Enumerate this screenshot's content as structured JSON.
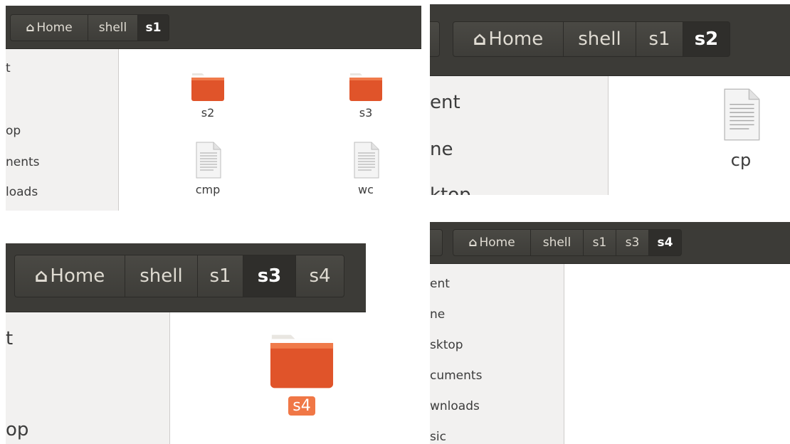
{
  "windows": [
    {
      "crumbs": [
        {
          "label": "Home",
          "home": true
        },
        {
          "label": "shell"
        },
        {
          "label": "s1",
          "active": true
        }
      ],
      "sidebar": [
        "t",
        "op",
        "nents",
        "loads"
      ],
      "files": [
        {
          "name": "s2",
          "type": "folder"
        },
        {
          "name": "s3",
          "type": "folder"
        },
        {
          "name": "cmp",
          "type": "document"
        },
        {
          "name": "wc",
          "type": "document"
        }
      ]
    },
    {
      "crumbs": [
        {
          "label": "Home",
          "home": true
        },
        {
          "label": "shell"
        },
        {
          "label": "s1"
        },
        {
          "label": "s2",
          "active": true
        }
      ],
      "sidebar": [
        "ent",
        "ne",
        "ktop"
      ],
      "files": [
        {
          "name": "cp",
          "type": "document"
        }
      ]
    },
    {
      "crumbs": [
        {
          "label": "Home",
          "home": true
        },
        {
          "label": "shell"
        },
        {
          "label": "s1"
        },
        {
          "label": "s3",
          "active": true
        },
        {
          "label": "s4"
        }
      ],
      "sidebar": [
        "t",
        "op"
      ],
      "files": [
        {
          "name": "s4",
          "type": "folder",
          "selected": true
        }
      ]
    },
    {
      "crumbs": [
        {
          "label": "Home",
          "home": true
        },
        {
          "label": "shell"
        },
        {
          "label": "s1"
        },
        {
          "label": "s3"
        },
        {
          "label": "s4",
          "active": true
        }
      ],
      "sidebar": [
        "ent",
        "ne",
        "sktop",
        "cuments",
        "wnloads",
        "sic"
      ],
      "files": []
    }
  ],
  "icons": {
    "home": "⌂"
  },
  "colors": {
    "toolbar": "#3c3b37",
    "folder": "#e0542a",
    "selection": "#f07746",
    "sidebar": "#f2f1f0"
  }
}
